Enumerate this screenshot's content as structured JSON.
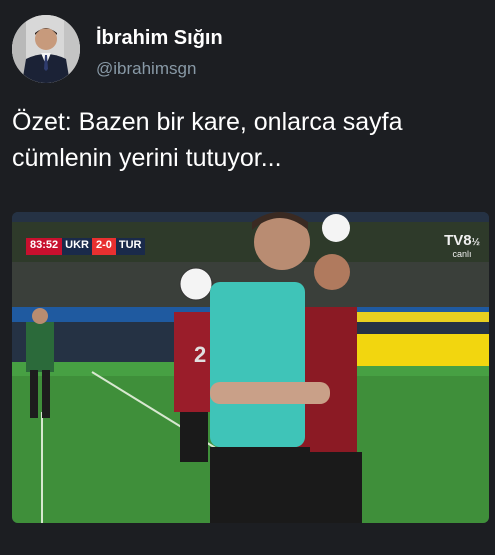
{
  "tweet": {
    "author_name": "İbrahim Sığın",
    "author_handle": "@ibrahimsgn",
    "text": "Özet: Bazen bir kare, onlarca sayfa cümlenin yerini tutuyor..."
  },
  "media": {
    "scoreboard": {
      "time": "83:52",
      "home": "UKR",
      "score": "2-0",
      "away": "TUR"
    },
    "channel": {
      "name": "TV8",
      "superscript": "½",
      "sub": "canlı"
    }
  },
  "colors": {
    "background": "#1c1e22",
    "handle": "#8899a6",
    "turkey_red": "#c8102e",
    "pitch_green": "#3f8f3a",
    "referee_teal": "#3fc4b8"
  }
}
